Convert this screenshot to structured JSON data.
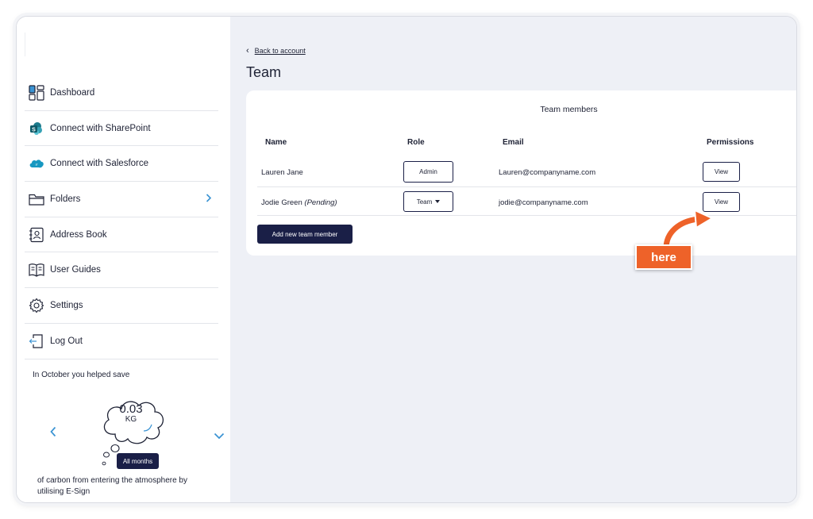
{
  "sidebar": {
    "items": [
      {
        "label": "Dashboard",
        "icon": "dashboard-icon"
      },
      {
        "label": "Connect with SharePoint",
        "icon": "sharepoint-icon"
      },
      {
        "label": "Connect with Salesforce",
        "icon": "salesforce-icon"
      },
      {
        "label": "Folders",
        "icon": "folder-icon"
      },
      {
        "label": "Address Book",
        "icon": "address-book-icon"
      },
      {
        "label": "User Guides",
        "icon": "book-icon"
      },
      {
        "label": "Settings",
        "icon": "gear-icon"
      },
      {
        "label": "Log Out",
        "icon": "logout-icon"
      }
    ],
    "eco": {
      "intro": "In October you helped save",
      "value": "0.03",
      "unit": "KG",
      "months_button": "All months",
      "outro": "of carbon from entering the atmosphere by utilising E-Sign"
    }
  },
  "main": {
    "back_link": "Back to account",
    "title": "Team",
    "card_title": "Team members",
    "columns": {
      "name": "Name",
      "role": "Role",
      "email": "Email",
      "permissions": "Permissions"
    },
    "rows": [
      {
        "name": "Lauren Jane",
        "pending": "",
        "role": "Admin",
        "email": "Lauren@companyname.com",
        "permission": "View"
      },
      {
        "name": "Jodie Green",
        "pending": "(Pending)",
        "role": "Team",
        "email": "jodie@companyname.com",
        "permission": "View"
      }
    ],
    "add_button": "Add new team member"
  },
  "annotation": {
    "label": "here",
    "color": "#ee6229"
  },
  "colors": {
    "navy": "#1a1f47",
    "accent_blue": "#3a93d3",
    "background": "#eef0f6"
  }
}
